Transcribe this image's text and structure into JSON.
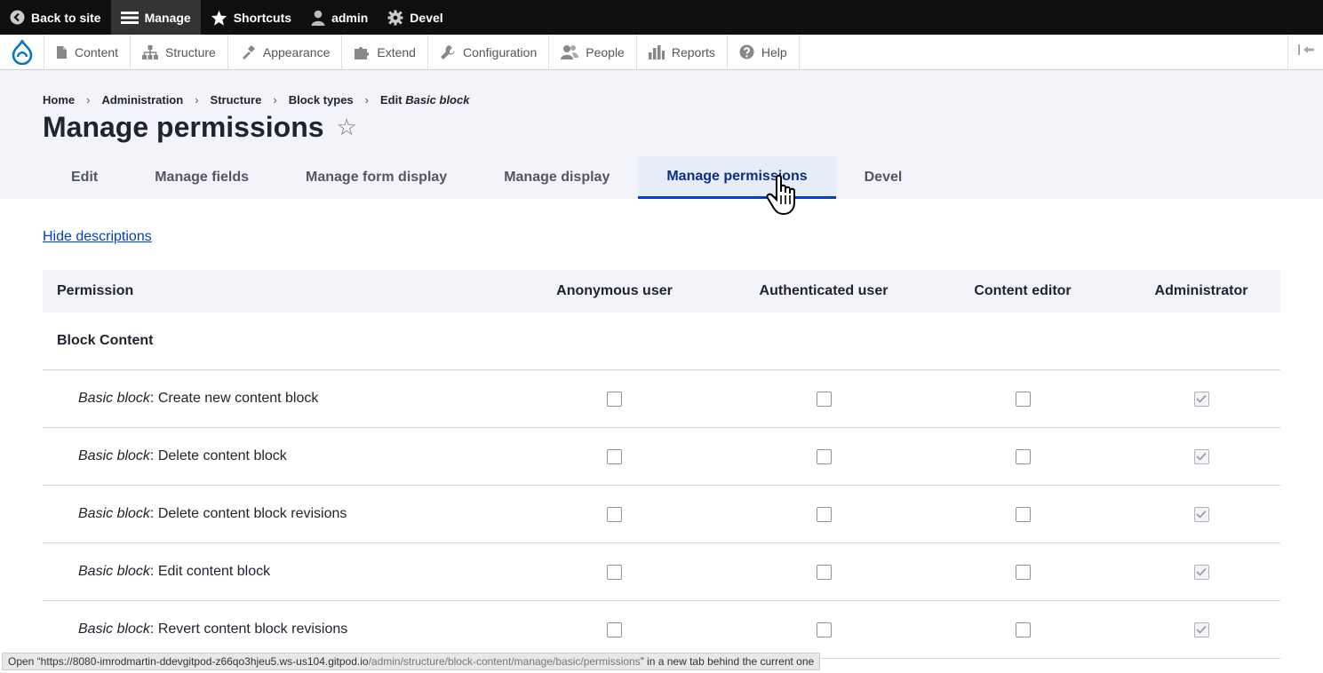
{
  "toolbar": {
    "back": "Back to site",
    "manage": "Manage",
    "shortcuts": "Shortcuts",
    "user": "admin",
    "devel": "Devel"
  },
  "admin_menu": [
    {
      "label": "Content",
      "icon": "file-icon"
    },
    {
      "label": "Structure",
      "icon": "sitemap-icon"
    },
    {
      "label": "Appearance",
      "icon": "paintbrush-icon"
    },
    {
      "label": "Extend",
      "icon": "puzzle-icon"
    },
    {
      "label": "Configuration",
      "icon": "wrench-icon"
    },
    {
      "label": "People",
      "icon": "people-icon"
    },
    {
      "label": "Reports",
      "icon": "bar-chart-icon"
    },
    {
      "label": "Help",
      "icon": "help-icon"
    }
  ],
  "breadcrumb": {
    "home": "Home",
    "administration": "Administration",
    "structure": "Structure",
    "block_types": "Block types",
    "edit_prefix": "Edit",
    "edit_em": "Basic block"
  },
  "page_title": "Manage permissions",
  "tabs": [
    "Edit",
    "Manage fields",
    "Manage form display",
    "Manage display",
    "Manage permissions",
    "Devel"
  ],
  "active_tab": "Manage permissions",
  "hide_descriptions": "Hide descriptions",
  "table": {
    "headers": [
      "Permission",
      "Anonymous user",
      "Authenticated user",
      "Content editor",
      "Administrator"
    ],
    "group": "Block Content",
    "rows": [
      {
        "em": "Basic block",
        "text": ": Create new content block",
        "checks": [
          false,
          false,
          false,
          true
        ]
      },
      {
        "em": "Basic block",
        "text": ": Delete content block",
        "checks": [
          false,
          false,
          false,
          true
        ]
      },
      {
        "em": "Basic block",
        "text": ": Delete content block revisions",
        "checks": [
          false,
          false,
          false,
          true
        ]
      },
      {
        "em": "Basic block",
        "text": ": Edit content block",
        "checks": [
          false,
          false,
          false,
          true
        ]
      },
      {
        "em": "Basic block",
        "text": ": Revert content block revisions",
        "checks": [
          false,
          false,
          false,
          true
        ]
      }
    ]
  },
  "status_bar": {
    "prefix": "Open “https://8080-imrodmartin-ddevgitpod-z66qo3hjeu5.ws-us104.gitpod.io",
    "path": "/admin/structure/block-content/manage/basic/permissions",
    "suffix": "” in a new tab behind the current one"
  },
  "colors": {
    "link": "#003ecc",
    "toolbar": "#0f0f0f",
    "header_bg": "#f3f4f9"
  }
}
